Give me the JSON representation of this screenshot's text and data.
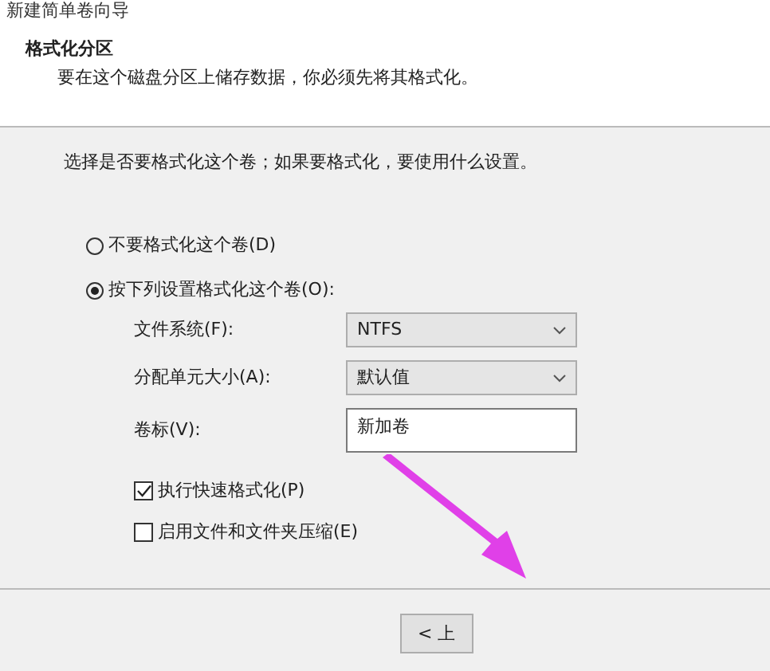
{
  "window": {
    "title": "新建简单卷向导"
  },
  "header": {
    "title": "格式化分区",
    "subtitle": "要在这个磁盘分区上储存数据，你必须先将其格式化。"
  },
  "instruction": "选择是否要格式化这个卷；如果要格式化，要使用什么设置。",
  "options": [
    {
      "label": "不要格式化这个卷(D)",
      "selected": false
    },
    {
      "label": "按下列设置格式化这个卷(O):",
      "selected": true
    }
  ],
  "settings": [
    {
      "kind": "dropdown",
      "label": "文件系统(F):",
      "value": "NTFS"
    },
    {
      "kind": "dropdown",
      "label": "分配单元大小(A):",
      "value": "默认值"
    },
    {
      "kind": "text",
      "label": "卷标(V):",
      "value": "新加卷"
    }
  ],
  "checkboxes": [
    {
      "label": "执行快速格式化(P)",
      "checked": true
    },
    {
      "label": "启用文件和文件夹压缩(E)",
      "checked": false
    }
  ],
  "buttons": [
    "< 上"
  ]
}
